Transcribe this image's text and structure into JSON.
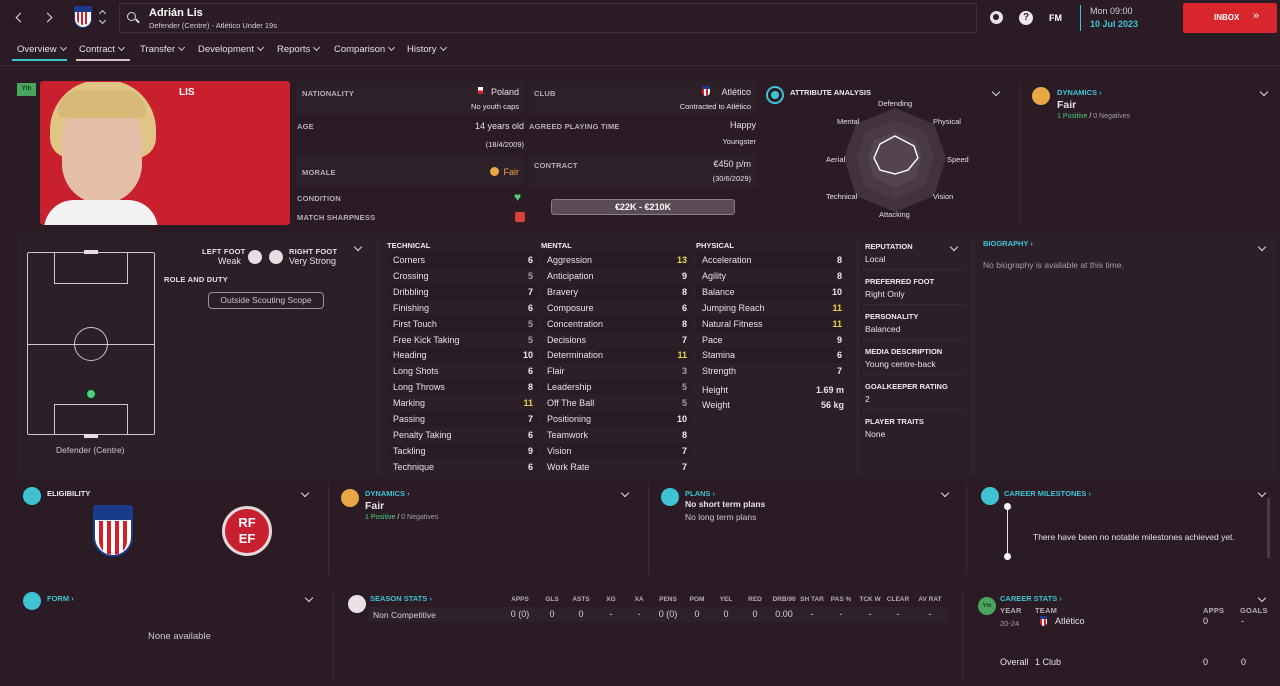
{
  "header": {
    "name": "Adrián Lis",
    "sub": "Defender (Centre) - Atlético Under 19s",
    "date_time": "Mon 09:00",
    "date": "10 Jul 2023",
    "inbox": "INBOX",
    "fm": "FM"
  },
  "nav": [
    "Overview",
    "Contract",
    "Transfer",
    "Development",
    "Reports",
    "Comparison",
    "History"
  ],
  "profile": {
    "tag": "Yth",
    "shirt_name": "LIS",
    "nationality_label": "NATIONALITY",
    "nationality": "Poland",
    "youth_caps": "No youth caps",
    "age_label": "AGE",
    "age": "14 years old",
    "dob": "(18/4/2009)",
    "morale_label": "MORALE",
    "morale": "Fair",
    "condition_label": "CONDITION",
    "sharpness_label": "MATCH SHARPNESS",
    "club_label": "CLUB",
    "club": "Atlético",
    "contracted": "Contracted to Atlético",
    "apt_label": "AGREED PLAYING TIME",
    "apt": "Happy",
    "apt2": "Youngster",
    "contract_label": "CONTRACT",
    "wage": "€450 p/m",
    "expiry": "(30/6/2029)",
    "value": "€22K - €210K"
  },
  "attr_analysis": {
    "title": "ATTRIBUTE ANALYSIS",
    "labels": [
      "Defending",
      "Physical",
      "Speed",
      "Vision",
      "Attacking",
      "Technical",
      "Aerial",
      "Mental"
    ]
  },
  "dynamics": {
    "title": "DYNAMICS",
    "value": "Fair",
    "positive": "1 Positive",
    "negative": "0 Negatives",
    "sep": "/"
  },
  "pitch": {
    "left_foot_label": "LEFT FOOT",
    "left_foot": "Weak",
    "right_foot_label": "RIGHT FOOT",
    "right_foot": "Very Strong",
    "role_label": "ROLE AND DUTY",
    "scope": "Outside Scouting Scope",
    "position": "Defender (Centre)"
  },
  "technical": {
    "title": "TECHNICAL",
    "items": [
      [
        "Corners",
        "6"
      ],
      [
        "Crossing",
        "5"
      ],
      [
        "Dribbling",
        "7"
      ],
      [
        "Finishing",
        "6"
      ],
      [
        "First Touch",
        "5"
      ],
      [
        "Free Kick Taking",
        "5"
      ],
      [
        "Heading",
        "10"
      ],
      [
        "Long Shots",
        "6"
      ],
      [
        "Long Throws",
        "8"
      ],
      [
        "Marking",
        "11"
      ],
      [
        "Passing",
        "7"
      ],
      [
        "Penalty Taking",
        "6"
      ],
      [
        "Tackling",
        "9"
      ],
      [
        "Technique",
        "6"
      ]
    ]
  },
  "mental": {
    "title": "MENTAL",
    "items": [
      [
        "Aggression",
        "13"
      ],
      [
        "Anticipation",
        "9"
      ],
      [
        "Bravery",
        "8"
      ],
      [
        "Composure",
        "6"
      ],
      [
        "Concentration",
        "8"
      ],
      [
        "Decisions",
        "7"
      ],
      [
        "Determination",
        "11"
      ],
      [
        "Flair",
        "3"
      ],
      [
        "Leadership",
        "5"
      ],
      [
        "Off The Ball",
        "5"
      ],
      [
        "Positioning",
        "10"
      ],
      [
        "Teamwork",
        "8"
      ],
      [
        "Vision",
        "7"
      ],
      [
        "Work Rate",
        "7"
      ]
    ]
  },
  "physical": {
    "title": "PHYSICAL",
    "items": [
      [
        "Acceleration",
        "8"
      ],
      [
        "Agility",
        "8"
      ],
      [
        "Balance",
        "10"
      ],
      [
        "Jumping Reach",
        "11"
      ],
      [
        "Natural Fitness",
        "11"
      ],
      [
        "Pace",
        "9"
      ],
      [
        "Stamina",
        "6"
      ],
      [
        "Strength",
        "7"
      ]
    ],
    "height_label": "Height",
    "height": "1.69 m",
    "weight_label": "Weight",
    "weight": "56 kg"
  },
  "info": [
    [
      "REPUTATION",
      "Local"
    ],
    [
      "PREFERRED FOOT",
      "Right Only"
    ],
    [
      "PERSONALITY",
      "Balanced"
    ],
    [
      "MEDIA DESCRIPTION",
      "Young centre-back"
    ],
    [
      "GOALKEEPER RATING",
      "2"
    ],
    [
      "PLAYER TRAITS",
      "None"
    ]
  ],
  "biography": {
    "title": "BIOGRAPHY",
    "text": "No biography is available at this time."
  },
  "eligibility": {
    "title": "ELIGIBILITY",
    "rfef": [
      "RF",
      "EF"
    ]
  },
  "plans": {
    "title": "PLANS",
    "short": "No short term plans",
    "long": "No long term plans"
  },
  "milestones": {
    "title": "CAREER MILESTONES",
    "text": "There have been no notable milestones achieved yet."
  },
  "form": {
    "title": "FORM",
    "text": "None available"
  },
  "season": {
    "title": "SEASON STATS",
    "headers": [
      "APPS",
      "GLS",
      "ASTS",
      "XG",
      "XA",
      "PENS",
      "POM",
      "YEL",
      "RED",
      "DRB/90",
      "SH TAR",
      "PAS %",
      "TCK W",
      "CLEAR",
      "AV RAT"
    ],
    "row_label": "Non Competitive",
    "values": [
      "0 (0)",
      "0",
      "0",
      "-",
      "-",
      "0 (0)",
      "0",
      "0",
      "0",
      "0.00",
      "-",
      "-",
      "-",
      "-",
      "-"
    ]
  },
  "career": {
    "title": "CAREER STATS",
    "tag": "Yth",
    "year_h": "YEAR",
    "team_h": "TEAM",
    "apps_h": "APPS",
    "goals_h": "GOALS",
    "year": "20-24",
    "team": "Atlético",
    "apps": "0",
    "goals": "-",
    "overall": "Overall",
    "clubs": "1 Club",
    "o_apps": "0",
    "o_goals": "0"
  },
  "colors": {
    "bg": "#2a1b25",
    "panel": "#2e2029",
    "accent": "#3fc3d4",
    "inbox": "#d9262d",
    "highlight": "#e6d64a",
    "positive": "#4cd07d"
  }
}
